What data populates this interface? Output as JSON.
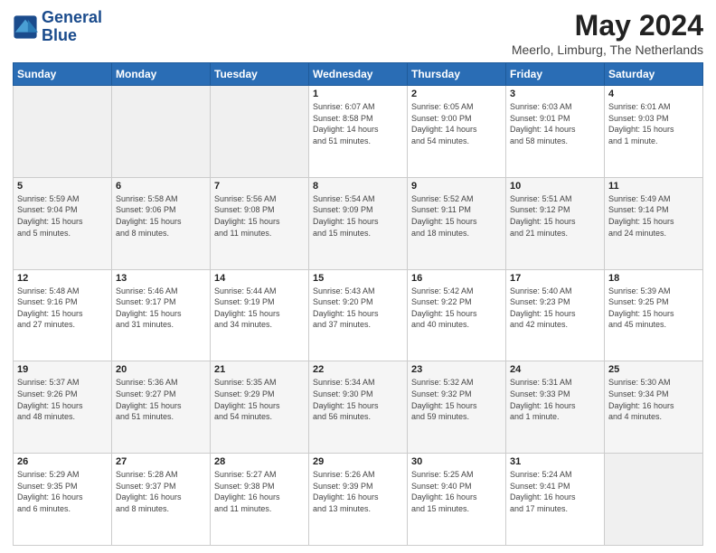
{
  "header": {
    "logo_line1": "General",
    "logo_line2": "Blue",
    "month_title": "May 2024",
    "location": "Meerlo, Limburg, The Netherlands"
  },
  "weekdays": [
    "Sunday",
    "Monday",
    "Tuesday",
    "Wednesday",
    "Thursday",
    "Friday",
    "Saturday"
  ],
  "weeks": [
    [
      {
        "day": "",
        "info": ""
      },
      {
        "day": "",
        "info": ""
      },
      {
        "day": "",
        "info": ""
      },
      {
        "day": "1",
        "info": "Sunrise: 6:07 AM\nSunset: 8:58 PM\nDaylight: 14 hours\nand 51 minutes."
      },
      {
        "day": "2",
        "info": "Sunrise: 6:05 AM\nSunset: 9:00 PM\nDaylight: 14 hours\nand 54 minutes."
      },
      {
        "day": "3",
        "info": "Sunrise: 6:03 AM\nSunset: 9:01 PM\nDaylight: 14 hours\nand 58 minutes."
      },
      {
        "day": "4",
        "info": "Sunrise: 6:01 AM\nSunset: 9:03 PM\nDaylight: 15 hours\nand 1 minute."
      }
    ],
    [
      {
        "day": "5",
        "info": "Sunrise: 5:59 AM\nSunset: 9:04 PM\nDaylight: 15 hours\nand 5 minutes."
      },
      {
        "day": "6",
        "info": "Sunrise: 5:58 AM\nSunset: 9:06 PM\nDaylight: 15 hours\nand 8 minutes."
      },
      {
        "day": "7",
        "info": "Sunrise: 5:56 AM\nSunset: 9:08 PM\nDaylight: 15 hours\nand 11 minutes."
      },
      {
        "day": "8",
        "info": "Sunrise: 5:54 AM\nSunset: 9:09 PM\nDaylight: 15 hours\nand 15 minutes."
      },
      {
        "day": "9",
        "info": "Sunrise: 5:52 AM\nSunset: 9:11 PM\nDaylight: 15 hours\nand 18 minutes."
      },
      {
        "day": "10",
        "info": "Sunrise: 5:51 AM\nSunset: 9:12 PM\nDaylight: 15 hours\nand 21 minutes."
      },
      {
        "day": "11",
        "info": "Sunrise: 5:49 AM\nSunset: 9:14 PM\nDaylight: 15 hours\nand 24 minutes."
      }
    ],
    [
      {
        "day": "12",
        "info": "Sunrise: 5:48 AM\nSunset: 9:16 PM\nDaylight: 15 hours\nand 27 minutes."
      },
      {
        "day": "13",
        "info": "Sunrise: 5:46 AM\nSunset: 9:17 PM\nDaylight: 15 hours\nand 31 minutes."
      },
      {
        "day": "14",
        "info": "Sunrise: 5:44 AM\nSunset: 9:19 PM\nDaylight: 15 hours\nand 34 minutes."
      },
      {
        "day": "15",
        "info": "Sunrise: 5:43 AM\nSunset: 9:20 PM\nDaylight: 15 hours\nand 37 minutes."
      },
      {
        "day": "16",
        "info": "Sunrise: 5:42 AM\nSunset: 9:22 PM\nDaylight: 15 hours\nand 40 minutes."
      },
      {
        "day": "17",
        "info": "Sunrise: 5:40 AM\nSunset: 9:23 PM\nDaylight: 15 hours\nand 42 minutes."
      },
      {
        "day": "18",
        "info": "Sunrise: 5:39 AM\nSunset: 9:25 PM\nDaylight: 15 hours\nand 45 minutes."
      }
    ],
    [
      {
        "day": "19",
        "info": "Sunrise: 5:37 AM\nSunset: 9:26 PM\nDaylight: 15 hours\nand 48 minutes."
      },
      {
        "day": "20",
        "info": "Sunrise: 5:36 AM\nSunset: 9:27 PM\nDaylight: 15 hours\nand 51 minutes."
      },
      {
        "day": "21",
        "info": "Sunrise: 5:35 AM\nSunset: 9:29 PM\nDaylight: 15 hours\nand 54 minutes."
      },
      {
        "day": "22",
        "info": "Sunrise: 5:34 AM\nSunset: 9:30 PM\nDaylight: 15 hours\nand 56 minutes."
      },
      {
        "day": "23",
        "info": "Sunrise: 5:32 AM\nSunset: 9:32 PM\nDaylight: 15 hours\nand 59 minutes."
      },
      {
        "day": "24",
        "info": "Sunrise: 5:31 AM\nSunset: 9:33 PM\nDaylight: 16 hours\nand 1 minute."
      },
      {
        "day": "25",
        "info": "Sunrise: 5:30 AM\nSunset: 9:34 PM\nDaylight: 16 hours\nand 4 minutes."
      }
    ],
    [
      {
        "day": "26",
        "info": "Sunrise: 5:29 AM\nSunset: 9:35 PM\nDaylight: 16 hours\nand 6 minutes."
      },
      {
        "day": "27",
        "info": "Sunrise: 5:28 AM\nSunset: 9:37 PM\nDaylight: 16 hours\nand 8 minutes."
      },
      {
        "day": "28",
        "info": "Sunrise: 5:27 AM\nSunset: 9:38 PM\nDaylight: 16 hours\nand 11 minutes."
      },
      {
        "day": "29",
        "info": "Sunrise: 5:26 AM\nSunset: 9:39 PM\nDaylight: 16 hours\nand 13 minutes."
      },
      {
        "day": "30",
        "info": "Sunrise: 5:25 AM\nSunset: 9:40 PM\nDaylight: 16 hours\nand 15 minutes."
      },
      {
        "day": "31",
        "info": "Sunrise: 5:24 AM\nSunset: 9:41 PM\nDaylight: 16 hours\nand 17 minutes."
      },
      {
        "day": "",
        "info": ""
      }
    ]
  ]
}
